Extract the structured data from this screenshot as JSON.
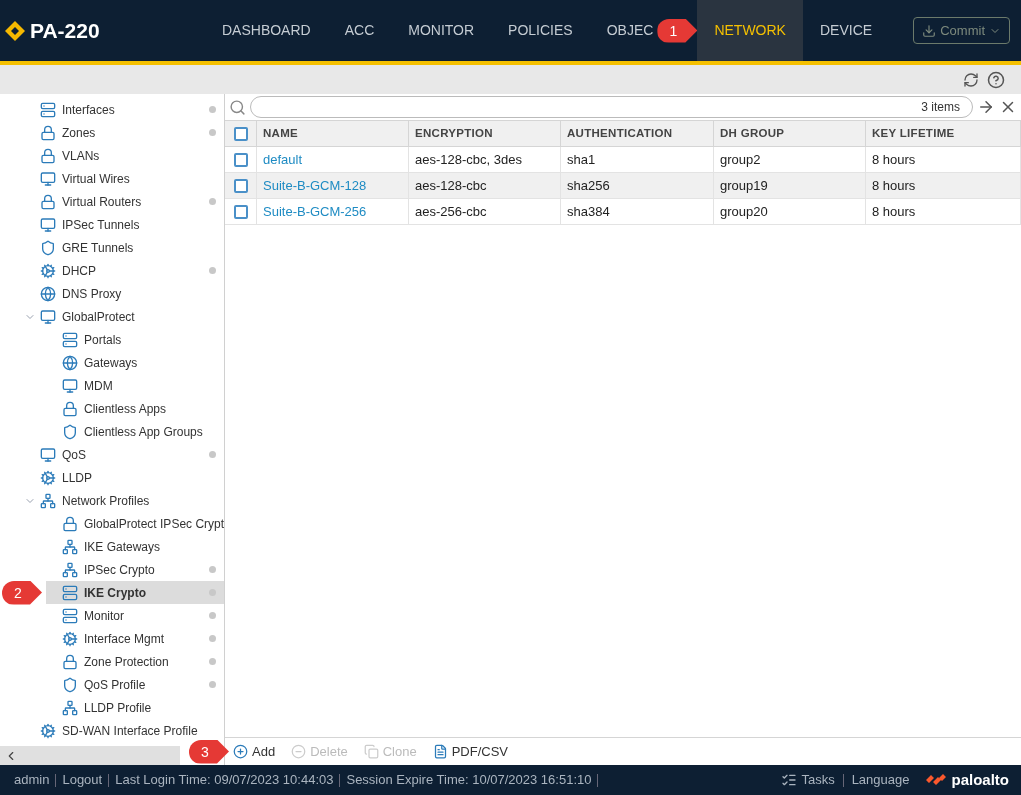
{
  "header": {
    "logo": "PA-220",
    "tabs": [
      {
        "label": "DASHBOARD",
        "selected": false
      },
      {
        "label": "ACC",
        "selected": false
      },
      {
        "label": "MONITOR",
        "selected": false
      },
      {
        "label": "POLICIES",
        "selected": false
      },
      {
        "label": "OBJEC",
        "selected": false
      },
      {
        "label": "NETWORK",
        "selected": true,
        "callout": "1"
      },
      {
        "label": "DEVICE",
        "selected": false
      }
    ],
    "commit": {
      "label": "Commit",
      "disabled": true
    }
  },
  "sidebar": {
    "items": [
      {
        "label": "Interfaces",
        "dot": true,
        "selected": false
      },
      {
        "label": "Zones",
        "dot": true,
        "selected": false
      },
      {
        "label": "VLANs",
        "dot": false,
        "selected": false
      },
      {
        "label": "Virtual Wires",
        "dot": false,
        "selected": false
      },
      {
        "label": "Virtual Routers",
        "dot": true,
        "selected": false
      },
      {
        "label": "IPSec Tunnels",
        "dot": false,
        "selected": false
      },
      {
        "label": "GRE Tunnels",
        "dot": false,
        "selected": false
      },
      {
        "label": "DHCP",
        "dot": true,
        "selected": false
      },
      {
        "label": "DNS Proxy",
        "dot": false,
        "selected": false
      },
      {
        "label": "GlobalProtect",
        "dot": false,
        "selected": false,
        "expanded": true,
        "children": [
          {
            "label": "Portals",
            "dot": false,
            "selected": false
          },
          {
            "label": "Gateways",
            "dot": false,
            "selected": false
          },
          {
            "label": "MDM",
            "dot": false,
            "selected": false
          },
          {
            "label": "Clientless Apps",
            "dot": false,
            "selected": false
          },
          {
            "label": "Clientless App Groups",
            "dot": false,
            "selected": false
          }
        ]
      },
      {
        "label": "QoS",
        "dot": true,
        "selected": false
      },
      {
        "label": "LLDP",
        "dot": false,
        "selected": false
      },
      {
        "label": "Network Profiles",
        "dot": false,
        "selected": false,
        "expanded": true,
        "children": [
          {
            "label": "GlobalProtect IPSec Crypt",
            "dot": false,
            "selected": false
          },
          {
            "label": "IKE Gateways",
            "dot": false,
            "selected": false
          },
          {
            "label": "IPSec Crypto",
            "dot": true,
            "selected": false
          },
          {
            "label": "IKE Crypto",
            "dot": true,
            "selected": true,
            "callout": "2"
          },
          {
            "label": "Monitor",
            "dot": true,
            "selected": false
          },
          {
            "label": "Interface Mgmt",
            "dot": true,
            "selected": false
          },
          {
            "label": "Zone Protection",
            "dot": true,
            "selected": false
          },
          {
            "label": "QoS Profile",
            "dot": true,
            "selected": false
          },
          {
            "label": "LLDP Profile",
            "dot": false,
            "selected": false
          }
        ]
      },
      {
        "label": "SD-WAN Interface Profile",
        "dot": false,
        "selected": false
      }
    ]
  },
  "filter": {
    "count": "3 items"
  },
  "table": {
    "header_checked": false,
    "columns": [
      "NAME",
      "ENCRYPTION",
      "AUTHENTICATION",
      "DH GROUP",
      "KEY LIFETIME"
    ],
    "rows": [
      {
        "checked": false,
        "cells": [
          "default",
          "aes-128-cbc, 3des",
          "sha1",
          "group2",
          "8 hours"
        ]
      },
      {
        "checked": false,
        "cells": [
          "Suite-B-GCM-128",
          "aes-128-cbc",
          "sha256",
          "group19",
          "8 hours"
        ]
      },
      {
        "checked": false,
        "cells": [
          "Suite-B-GCM-256",
          "aes-256-cbc",
          "sha384",
          "group20",
          "8 hours"
        ]
      }
    ]
  },
  "actions": [
    {
      "kind": "add",
      "label": "Add",
      "disabled": false,
      "callout": "3"
    },
    {
      "kind": "delete",
      "label": "Delete",
      "disabled": true
    },
    {
      "kind": "clone",
      "label": "Clone",
      "disabled": true
    },
    {
      "kind": "export",
      "label": "PDF/CSV",
      "disabled": false
    }
  ],
  "status_bar": {
    "items": [
      "admin",
      "Logout",
      "Last Login Time: 09/07/2023 10:44:03",
      "Session Expire Time: 10/07/2023 16:51:10"
    ],
    "tasks": "Tasks",
    "language": "Language",
    "brand": "paloalto"
  }
}
